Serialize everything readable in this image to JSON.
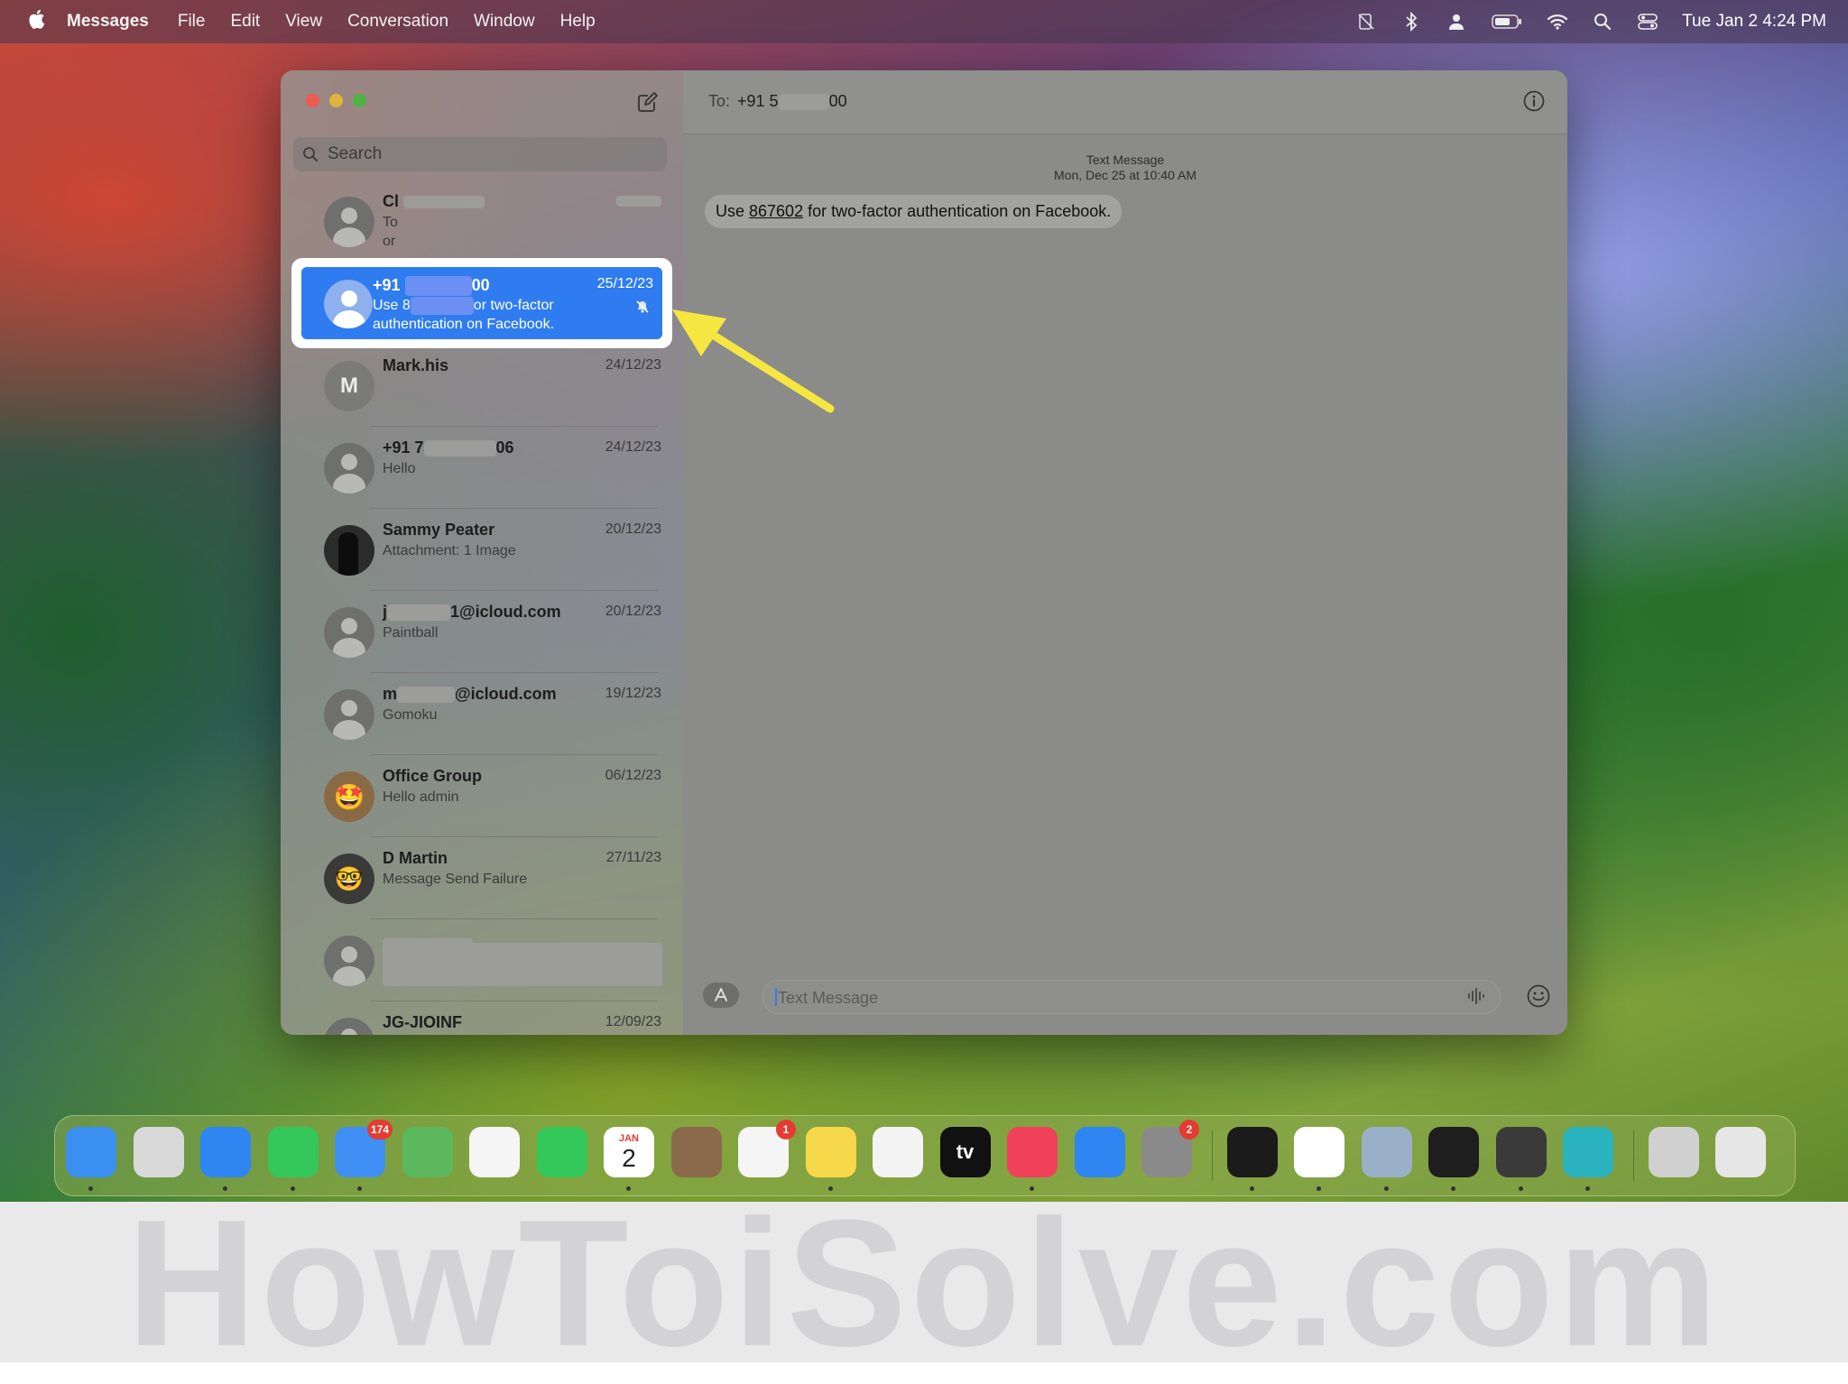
{
  "menubar": {
    "app_name": "Messages",
    "items": [
      "File",
      "Edit",
      "View",
      "Conversation",
      "Window",
      "Help"
    ],
    "clock": "Tue Jan 2  4:24 PM",
    "status_icons": [
      "screen-mirroring-off-icon",
      "bluetooth-icon",
      "user-icon",
      "battery-icon",
      "wifi-icon",
      "spotlight-search-icon",
      "control-center-icon"
    ]
  },
  "sidebar": {
    "search_placeholder": "Search",
    "conversations": [
      {
        "name": "Cl",
        "date": "",
        "preview": "To",
        "preview2": "or",
        "avatar": "person"
      },
      {
        "name": "+91",
        "name_suffix": "00",
        "date": "25/12/23",
        "preview": "Use 8",
        "preview_suffix": "or two-factor",
        "preview2": "authentication on Facebook.",
        "avatar": "person",
        "selected": true,
        "muted": true
      },
      {
        "name": "Mark.his",
        "date": "24/12/23",
        "preview": "",
        "avatar": "letter",
        "letter": "M"
      },
      {
        "name": "+91 7",
        "name_suffix": "06",
        "date": "24/12/23",
        "preview": "Hello",
        "avatar": "person"
      },
      {
        "name": "Sammy Peater",
        "date": "20/12/23",
        "preview": "Attachment: 1 Image",
        "avatar": "photo"
      },
      {
        "name": "j",
        "name_suffix": "1@icloud.com",
        "date": "20/12/23",
        "preview": "Paintball",
        "avatar": "person"
      },
      {
        "name": "m",
        "name_suffix": "@icloud.com",
        "date": "19/12/23",
        "preview": "Gomoku",
        "avatar": "person"
      },
      {
        "name": "Office Group",
        "date": "06/12/23",
        "preview": "Hello admin",
        "avatar": "emoji",
        "emoji": "🤩"
      },
      {
        "name": "D Martin",
        "date": "27/11/23",
        "preview": "Message Send Failure",
        "avatar": "emoji2",
        "emoji": "🤓"
      },
      {
        "name": "",
        "date": "",
        "preview": "",
        "avatar": "person"
      },
      {
        "name": "JG-JIOINF",
        "date": "12/09/23",
        "preview": "",
        "avatar": "person"
      }
    ]
  },
  "conversation": {
    "to_label": "To:",
    "to_value": "+91 5",
    "to_suffix": "00",
    "meta_type": "Text Message",
    "meta_time": "Mon, Dec 25 at 10:40 AM",
    "message_prefix": "Use ",
    "message_code": "867602",
    "message_suffix": " for two-factor authentication on Facebook.",
    "composer_placeholder": "Text Message"
  },
  "dock": {
    "apps": [
      {
        "name": "Finder",
        "icon": "finder-icon",
        "color": "#3b8ff0",
        "running": true
      },
      {
        "name": "Launchpad",
        "icon": "launchpad-icon",
        "color": "#d9d9d9",
        "running": false
      },
      {
        "name": "Safari",
        "icon": "safari-icon",
        "color": "#2f86f2",
        "running": true
      },
      {
        "name": "Messages",
        "icon": "messages-icon",
        "color": "#35c759",
        "running": true
      },
      {
        "name": "Mail",
        "icon": "mail-icon",
        "color": "#3f8ff5",
        "running": true,
        "badge": "174"
      },
      {
        "name": "Maps",
        "icon": "maps-icon",
        "color": "#5cb85c",
        "running": false
      },
      {
        "name": "Photos",
        "icon": "photos-icon",
        "color": "#f5f5f5",
        "running": false
      },
      {
        "name": "FaceTime",
        "icon": "facetime-icon",
        "color": "#34c759",
        "running": false
      },
      {
        "name": "Calendar",
        "icon": "calendar-icon",
        "color": "#ffffff",
        "running": true,
        "month": "JAN",
        "day": "2"
      },
      {
        "name": "Contacts",
        "icon": "contacts-icon",
        "color": "#8a6a4a",
        "running": false
      },
      {
        "name": "Reminders",
        "icon": "reminders-icon",
        "color": "#f5f5f5",
        "running": false,
        "badge": "1"
      },
      {
        "name": "Notes",
        "icon": "notes-icon",
        "color": "#f7d84a",
        "running": true
      },
      {
        "name": "Freeform",
        "icon": "freeform-icon",
        "color": "#f4f4f4",
        "running": false
      },
      {
        "name": "Apple TV",
        "icon": "apple-tv-icon",
        "color": "#111111",
        "running": false,
        "label": "tv"
      },
      {
        "name": "Music",
        "icon": "music-icon",
        "color": "#f0405a",
        "running": true
      },
      {
        "name": "App Store",
        "icon": "app-store-icon",
        "color": "#2f86f2",
        "running": false
      },
      {
        "name": "System Settings",
        "icon": "system-settings-icon",
        "color": "#8a8a8a",
        "running": false,
        "badge": "2"
      },
      {
        "name": "Activity Monitor",
        "icon": "activity-monitor-icon",
        "color": "#1b1b1b",
        "running": true
      },
      {
        "name": "Chrome",
        "icon": "chrome-icon",
        "color": "#ffffff",
        "running": true
      },
      {
        "name": "Preview",
        "icon": "preview-icon",
        "color": "#9ab0c8",
        "running": true
      },
      {
        "name": "Terminal",
        "icon": "terminal-icon",
        "color": "#1e1e1e",
        "running": true
      },
      {
        "name": "Keychain Access",
        "icon": "keychain-icon",
        "color": "#3a3a3a",
        "running": true
      },
      {
        "name": "Surfshark",
        "icon": "surfshark-icon",
        "color": "#2bb3c0",
        "running": true
      },
      {
        "name": "Downloads",
        "icon": "downloads-folder-icon",
        "color": "#d0d0d0",
        "running": false
      },
      {
        "name": "Trash",
        "icon": "trash-icon",
        "color": "#e6e6e6",
        "running": false
      }
    ]
  },
  "watermark": "HowToiSolve.com",
  "colors": {
    "selection": "#2f7cf0",
    "arrow": "#f5e642",
    "badge": "#e53b30"
  }
}
